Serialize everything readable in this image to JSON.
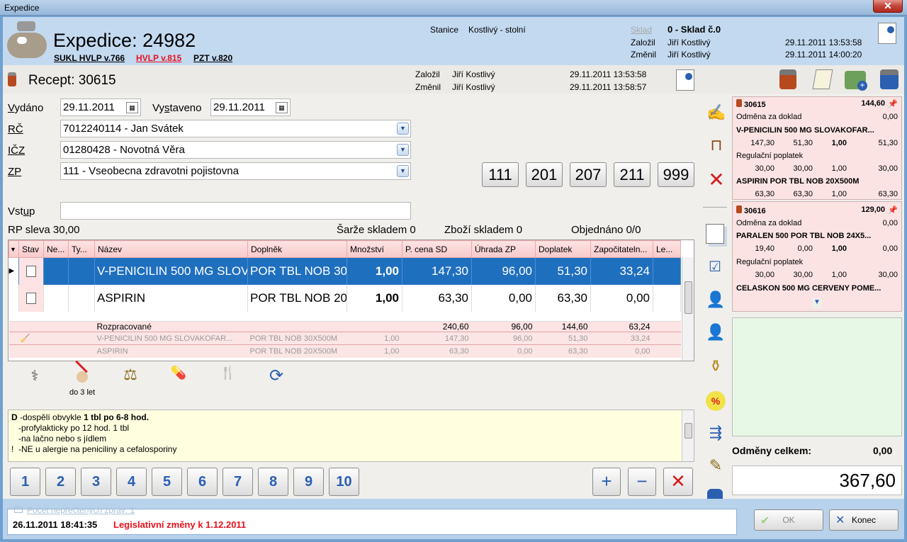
{
  "window": {
    "title": "Expedice"
  },
  "header": {
    "title": "Expedice: 24982",
    "sukl": "SUKL HVLP v.766",
    "hvlp": "HVLP v.815",
    "pzt": "PZT v.820",
    "stanice_label": "Stanice",
    "stanice_value": "Kostlivý - stolní",
    "sklad_label": "Sklad",
    "sklad_value": "0 - Sklad č.0",
    "zalozil_label": "Založil",
    "zalozil_value": "Jiří Kostlivý",
    "zalozil_time": "29.11.2011 13:53:58",
    "zmenil_label": "Změnil",
    "zmenil_value": "Jiří Kostlivý",
    "zmenil_time": "29.11.2011 14:00:20"
  },
  "recept": {
    "title": "Recept: 30615",
    "zalozil_label": "Založil",
    "zalozil_value": "Jiří Kostlivý",
    "zalozil_time": "29.11.2011 13:53:58",
    "zmenil_label": "Změnil",
    "zmenil_value": "Jiří Kostlivý",
    "zmenil_time": "29.11.2011 13:58:57"
  },
  "form": {
    "vydano_label": "Vydáno",
    "vydano_value": "29.11.2011",
    "vystaveno_label": "Vystaveno",
    "vystaveno_value": "29.11.2011",
    "rc_label": "RČ",
    "rc_value": "7012240114 - Jan Svátek",
    "icz_label": "IČZ",
    "icz_value": "01280428 - Novotná Věra",
    "zp_label": "ZP",
    "zp_value": "111 - Vseobecna zdravotni pojistovna",
    "vstup_label": "Vstup",
    "vstup_value": "",
    "rp_sleva": "RP sleva  30,00",
    "sarze": "Šarže skladem  0",
    "zbozi": "Zboží skladem  0",
    "objednano": "Objednáno  0/0",
    "codes": [
      "111",
      "201",
      "207",
      "211",
      "999"
    ]
  },
  "grid": {
    "headers": [
      "Stav",
      "Ne...",
      "Ty...",
      "Název",
      "Doplněk",
      "Množství",
      "P. cena SD",
      "Úhrada ZP",
      "Doplatek",
      "Započitateln...",
      "Le..."
    ],
    "rows": [
      {
        "nazev": "V-PENICILIN 500 MG SLOV...",
        "doplnek": "POR TBL NOB 30...",
        "mnozstvi": "1,00",
        "cena": "147,30",
        "uhrada": "96,00",
        "doplatek": "51,30",
        "zapocit": "33,24"
      },
      {
        "nazev": "ASPIRIN",
        "doplnek": "POR TBL NOB 20...",
        "mnozstvi": "1,00",
        "cena": "63,30",
        "uhrada": "0,00",
        "doplatek": "63,30",
        "zapocit": "0,00"
      }
    ],
    "sum": {
      "label": "Rozpracované",
      "cena": "240,60",
      "uhrada": "96,00",
      "doplatek": "144,60",
      "zapocit": "63,24"
    },
    "subrows": [
      {
        "nazev": "V-PENICILIN 500 MG SLOVAKOFAR...",
        "doplnek": "POR TBL NOB 30X500M",
        "mnozstvi": "1,00",
        "cena": "147,30",
        "uhrada": "96,00",
        "doplatek": "51,30",
        "zapocit": "33,24"
      },
      {
        "nazev": "ASPIRIN",
        "doplnek": "POR TBL NOB 20X500M",
        "mnozstvi": "1,00",
        "cena": "63,30",
        "uhrada": "0,00",
        "doplatek": "63,30",
        "zapocit": "0,00"
      }
    ]
  },
  "tools": {
    "do3let": "do 3 let"
  },
  "notes": {
    "prefix": "D",
    "l1a": " -dospělí obvykle ",
    "l1b": "1 tbl po 6-8 hod.",
    "l2": "   -profylakticky po 12 hod. 1 tbl",
    "l3": "   -na lačno nebo s jídlem",
    "l4": "!  -NE u alergie na peniciliny a cefalosporiny"
  },
  "numbers": [
    "1",
    "2",
    "3",
    "4",
    "5",
    "6",
    "7",
    "8",
    "9",
    "10"
  ],
  "cards": [
    {
      "id": "30615",
      "total": "144,60",
      "o_label": "Odměna za doklad",
      "o_value": "0,00",
      "drug": "V-PENICILIN 500 MG SLOVAKOFAR...",
      "v1": "147,30",
      "v2": "51,30",
      "v3": "1,00",
      "v4": "51,30",
      "r_label": "Regulační poplatek",
      "r1": "30,00",
      "r2": "30,00",
      "r3": "1,00",
      "r4": "30,00",
      "drug2": "ASPIRIN POR TBL NOB 20X500M",
      "w1": "63,30",
      "w2": "63,30",
      "w3": "1,00",
      "w4": "63,30"
    },
    {
      "id": "30616",
      "total": "129,00",
      "o_label": "Odměna za doklad",
      "o_value": "0,00",
      "drug": "PARALEN 500 POR TBL NOB 24X5...",
      "v1": "19,40",
      "v2": "0,00",
      "v3": "1,00",
      "v4": "0,00",
      "r_label": "Regulační poplatek",
      "r1": "30,00",
      "r2": "30,00",
      "r3": "1,00",
      "r4": "30,00",
      "drug2": "CELASKON 500 MG CERVENY POME..."
    }
  ],
  "odmeny": {
    "label": "Odměny celkem:",
    "value": "0,00"
  },
  "total": "367,60",
  "footer": {
    "msgs": "Počet nepřečtených zpráv: 1",
    "date": "26.11.2011 18:41:35",
    "legis": "Legislativní změny k 1.12.2011",
    "ok": "OK",
    "konec": "Konec"
  },
  "colors": {
    "selected": "#1f6fbf",
    "header_bg": "#c3d9ef",
    "red_text": "#e8101c"
  }
}
